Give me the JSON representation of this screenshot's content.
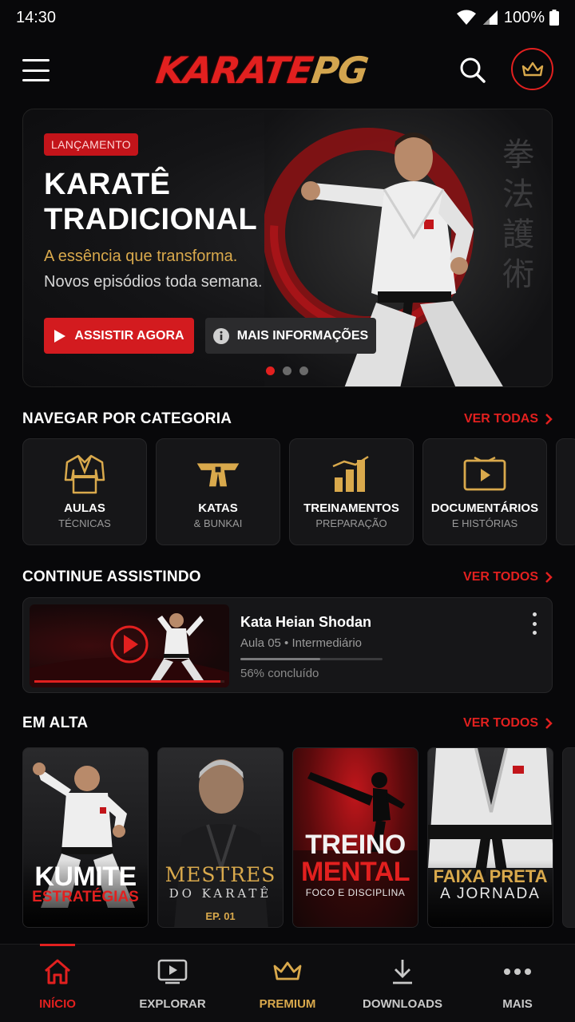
{
  "status_bar": {
    "time": "14:30",
    "battery": "100%"
  },
  "header": {
    "logo_part1": "KARATE",
    "logo_part2": "PG"
  },
  "hero": {
    "badge": "LANÇAMENTO",
    "title_line1": "KARATÊ",
    "title_line2": "TRADICIONAL",
    "tagline": "A essência que transforma.",
    "subtitle": "Novos episódios toda semana.",
    "primary_button": "ASSISTIR AGORA",
    "secondary_button": "MAIS INFORMAÇÕES",
    "slide_index": 1,
    "slide_count": 3
  },
  "categories": {
    "title": "NAVEGAR POR CATEGORIA",
    "link": "VER TODAS",
    "items": [
      {
        "title": "AULAS",
        "subtitle": "TÉCNICAS",
        "icon": "gi-icon"
      },
      {
        "title": "KATAS",
        "subtitle": "& BUNKAI",
        "icon": "belt-icon"
      },
      {
        "title": "TREINAMENTOS",
        "subtitle": "PREPARAÇÃO",
        "icon": "chart-icon"
      },
      {
        "title": "DOCUMENTÁRIOS",
        "subtitle": "E HISTÓRIAS",
        "icon": "tv-icon"
      }
    ]
  },
  "continue": {
    "title": "CONTINUE ASSISTINDO",
    "link": "VER TODOS",
    "item": {
      "title": "Kata Heian Shodan",
      "meta": "Aula 05 • Intermediário",
      "status": "56% concluído",
      "progress": 0.56,
      "thumb_progress": 0.98
    }
  },
  "trending": {
    "title": "EM ALTA",
    "link": "VER TODOS",
    "items": [
      {
        "line1": "KUMITE",
        "line2": "ESTRATÉGIAS",
        "line3": ""
      },
      {
        "line1": "MESTRES",
        "line2": "DO KARATÊ",
        "line3": "EP. 01"
      },
      {
        "line1": "TREINO",
        "line2": "MENTAL",
        "line3": "FOCO E DISCIPLINA"
      },
      {
        "line1": "FAIXA PRETA",
        "line2": "A JORNADA",
        "line3": ""
      }
    ]
  },
  "bottom_nav": {
    "items": [
      {
        "label": "INÍCIO",
        "icon": "home-icon"
      },
      {
        "label": "EXPLORAR",
        "icon": "play-box-icon"
      },
      {
        "label": "PREMIUM",
        "icon": "crown-icon"
      },
      {
        "label": "DOWNLOADS",
        "icon": "download-icon"
      },
      {
        "label": "MAIS",
        "icon": "more-icon"
      }
    ]
  },
  "colors": {
    "accent": "#e2201f",
    "gold": "#d9a94c",
    "background": "#08080a",
    "card": "#161618"
  }
}
